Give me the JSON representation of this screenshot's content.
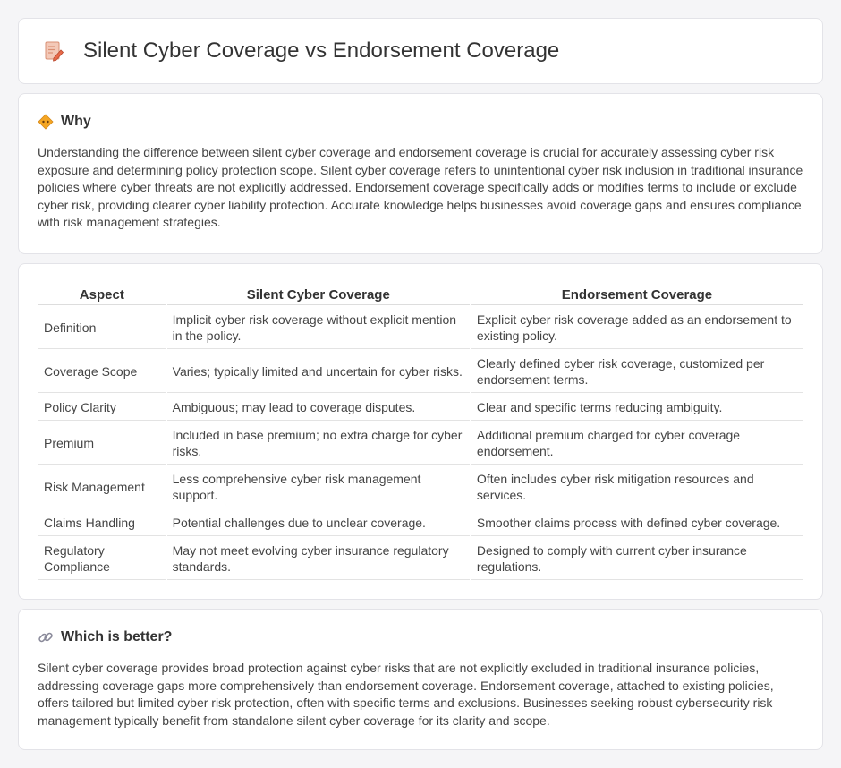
{
  "page": {
    "title": "Silent Cyber Coverage vs Endorsement Coverage",
    "title_icon": "document-pencil-icon"
  },
  "why": {
    "heading": "Why",
    "icon": "warning-diamond-icon",
    "text": "Understanding the difference between silent cyber coverage and endorsement coverage is crucial for accurately assessing cyber risk exposure and determining policy protection scope. Silent cyber coverage refers to unintentional cyber risk inclusion in traditional insurance policies where cyber threats are not explicitly addressed. Endorsement coverage specifically adds or modifies terms to include or exclude cyber risk, providing clearer cyber liability protection. Accurate knowledge helps businesses avoid coverage gaps and ensures compliance with risk management strategies."
  },
  "table": {
    "headers": [
      "Aspect",
      "Silent Cyber Coverage",
      "Endorsement Coverage"
    ],
    "rows": [
      [
        "Definition",
        "Implicit cyber risk coverage without explicit mention in the policy.",
        "Explicit cyber risk coverage added as an endorsement to existing policy."
      ],
      [
        "Coverage Scope",
        "Varies; typically limited and uncertain for cyber risks.",
        "Clearly defined cyber risk coverage, customized per endorsement terms."
      ],
      [
        "Policy Clarity",
        "Ambiguous; may lead to coverage disputes.",
        "Clear and specific terms reducing ambiguity."
      ],
      [
        "Premium",
        "Included in base premium; no extra charge for cyber risks.",
        "Additional premium charged for cyber coverage endorsement."
      ],
      [
        "Risk Management",
        "Less comprehensive cyber risk management support.",
        "Often includes cyber risk mitigation resources and services."
      ],
      [
        "Claims Handling",
        "Potential challenges due to unclear coverage.",
        "Smoother claims process with defined cyber coverage."
      ],
      [
        "Regulatory Compliance",
        "May not meet evolving cyber insurance regulatory standards.",
        "Designed to comply with current cyber insurance regulations."
      ]
    ]
  },
  "better": {
    "heading": "Which is better?",
    "icon": "link-icon",
    "text": "Silent cyber coverage provides broad protection against cyber risks that are not explicitly excluded in traditional insurance policies, addressing coverage gaps more comprehensively than endorsement coverage. Endorsement coverage, attached to existing policies, offers tailored but limited cyber risk protection, often with specific terms and exclusions. Businesses seeking robust cybersecurity risk management typically benefit from standalone silent cyber coverage for its clarity and scope."
  }
}
